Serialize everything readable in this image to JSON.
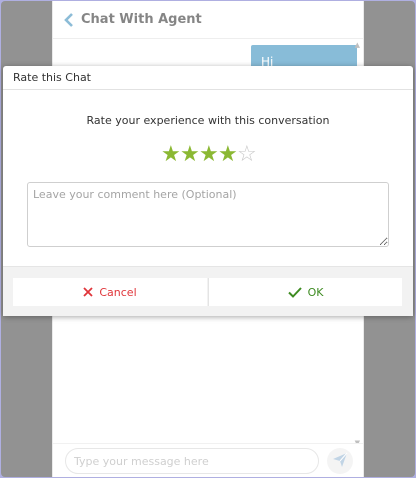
{
  "chat": {
    "title": "Chat With Agent",
    "back_icon": "chevron-left-icon",
    "messages": [
      {
        "from": "user",
        "text": "Hi"
      }
    ],
    "composer": {
      "placeholder": "Type your message here",
      "send_icon": "send-icon"
    }
  },
  "rating_dialog": {
    "title": "Rate this Chat",
    "prompt": "Rate your experience with this conversation",
    "rating": 4,
    "max_rating": 5,
    "comment_placeholder": "Leave your comment here (Optional)",
    "cancel_label": "Cancel",
    "ok_label": "OK",
    "cancel_icon": "close-icon",
    "ok_icon": "check-icon"
  },
  "colors": {
    "accent": "#2786b8",
    "star_on": "#8bb833",
    "star_off": "#c8c8c8",
    "cancel": "#e0353a",
    "ok": "#3d8b21",
    "page_border": "#6e6ec9"
  }
}
